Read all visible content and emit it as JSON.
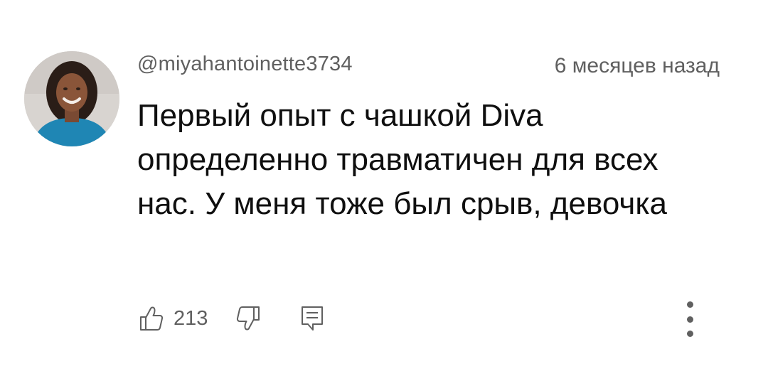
{
  "comment": {
    "author": "@miyahantoinette3734",
    "timestamp": "6 месяцев назад",
    "text": "Первый опыт с чашкой Diva определенно травматичен для всех нас. У меня тоже был срыв, девочка",
    "like_count": "213"
  },
  "icons": {
    "like": "thumb-up-icon",
    "dislike": "thumb-down-icon",
    "reply": "reply-comment-icon",
    "menu": "more-vertical-icon"
  },
  "colors": {
    "text_primary": "#0f0f0f",
    "text_secondary": "#606060",
    "background": "#ffffff"
  }
}
